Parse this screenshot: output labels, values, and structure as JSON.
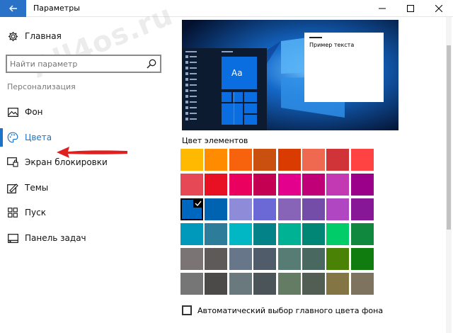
{
  "window": {
    "title": "Параметры",
    "accent_color": "#2a72c8"
  },
  "watermark": "All4os.ru",
  "sidebar": {
    "home_label": "Главная",
    "search": {
      "placeholder": "Найти параметр"
    },
    "section_label": "Персонализация",
    "items": [
      {
        "label": "Фон",
        "icon": "image-icon",
        "active": false
      },
      {
        "label": "Цвета",
        "icon": "palette-icon",
        "active": true
      },
      {
        "label": "Экран блокировки",
        "icon": "lock-screen-icon",
        "active": false
      },
      {
        "label": "Темы",
        "icon": "themes-icon",
        "active": false
      },
      {
        "label": "Пуск",
        "icon": "start-icon",
        "active": false
      },
      {
        "label": "Панель задач",
        "icon": "taskbar-icon",
        "active": false
      }
    ]
  },
  "main": {
    "preview": {
      "sample_text": "Пример текста",
      "tile_label": "Aa"
    },
    "colors_title": "Цвет элементов",
    "selected_color": "#0067c0",
    "swatches": [
      [
        "#ffb900",
        "#ff8c00",
        "#f7630c",
        "#ca5010",
        "#da3b01",
        "#ef6950",
        "#d13438",
        "#ff4343"
      ],
      [
        "#e74856",
        "#e81123",
        "#ea005e",
        "#c30052",
        "#e3008c",
        "#bf0077",
        "#c239b3",
        "#9a0089"
      ],
      [
        "#0078d7",
        "#0063b1",
        "#8e8cd8",
        "#6b69d6",
        "#8764b8",
        "#744da9",
        "#b146c2",
        "#881798"
      ],
      [
        "#0099bc",
        "#2d7d9a",
        "#00b7c3",
        "#038387",
        "#00b294",
        "#018574",
        "#00cc6a",
        "#10893e"
      ],
      [
        "#7a7574",
        "#5d5a58",
        "#68768a",
        "#515c6b",
        "#567c73",
        "#486860",
        "#498205",
        "#107c10"
      ],
      [
        "#767676",
        "#4c4a48",
        "#69797e",
        "#4a5459",
        "#647c64",
        "#525e54",
        "#847545",
        "#7e735f"
      ]
    ],
    "auto_checkbox_label": "Автоматический выбор главного цвета фона",
    "auto_checked": false
  }
}
